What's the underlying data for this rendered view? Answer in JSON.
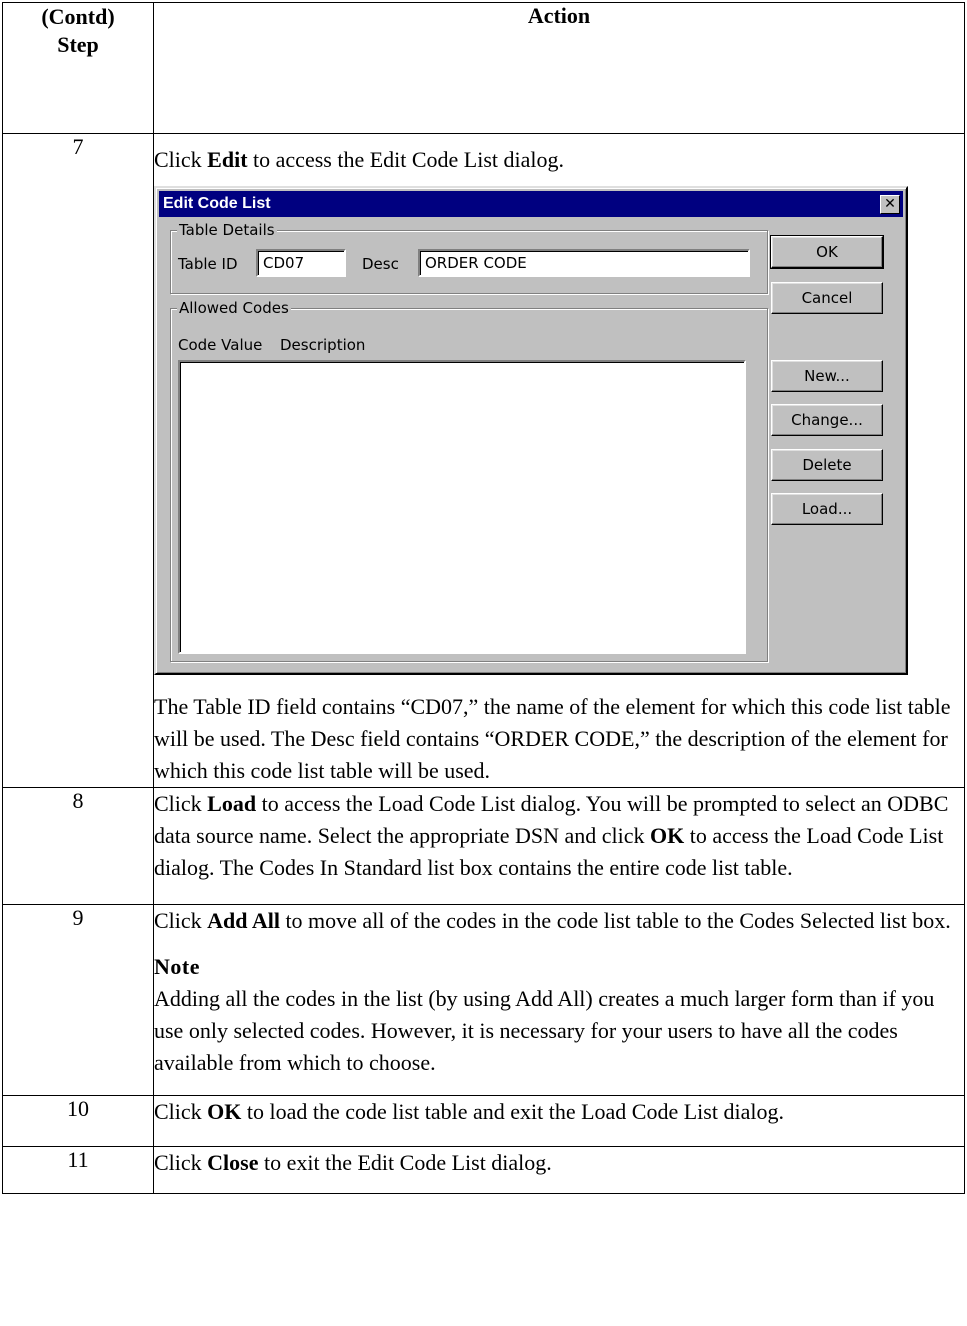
{
  "header": {
    "step_line1": "(Contd)",
    "step_line2": "Step",
    "action": "Action"
  },
  "rows": [
    {
      "num": "7",
      "intro_pre": "Click ",
      "intro_bold": "Edit",
      "intro_post": " to access the Edit Code List dialog.",
      "after": "The Table ID field contains “CD07,” the name of the element for which this code list table will be used. The Desc field contains “ORDER CODE,” the description of the element for which this code list table will be used."
    },
    {
      "num": "8",
      "p1": "Click ",
      "b1": "Load",
      "p2": " to access the Load Code List dialog. You will be prompted to select an ODBC data source name. Select the appropriate DSN and click ",
      "b2": "OK",
      "p3": " to access the Load Code List dialog. The Codes In Standard list box contains the entire code list table."
    },
    {
      "num": "9",
      "p1": "Click ",
      "b1": "Add All",
      "p2": " to move all of the codes in the code list table to the Codes Selected list box.",
      "note_title": "Note",
      "note_text": "Adding all the codes in the list (by using Add All) creates a much larger form than if you use only selected codes. However, it is necessary for your users to have all the codes available from which to choose."
    },
    {
      "num": "10",
      "p1": "Click ",
      "b1": "OK",
      "p2": " to load the code list table and exit the Load Code List dialog."
    },
    {
      "num": "11",
      "p1": "Click ",
      "b1": "Close",
      "p2": " to exit the Edit Code List dialog."
    }
  ],
  "dialog": {
    "title": "Edit Code List",
    "close_glyph": "✕",
    "table_details_label": "Table Details",
    "table_id_label": "Table ID",
    "table_id_value": "CD07",
    "desc_label": "Desc",
    "desc_value": "ORDER CODE",
    "allowed_codes_label": "Allowed Codes",
    "col_code_value": "Code Value",
    "col_description": "Description",
    "buttons": {
      "ok": "OK",
      "cancel": "Cancel",
      "new": "New...",
      "change": "Change...",
      "delete": "Delete",
      "load": "Load..."
    }
  }
}
